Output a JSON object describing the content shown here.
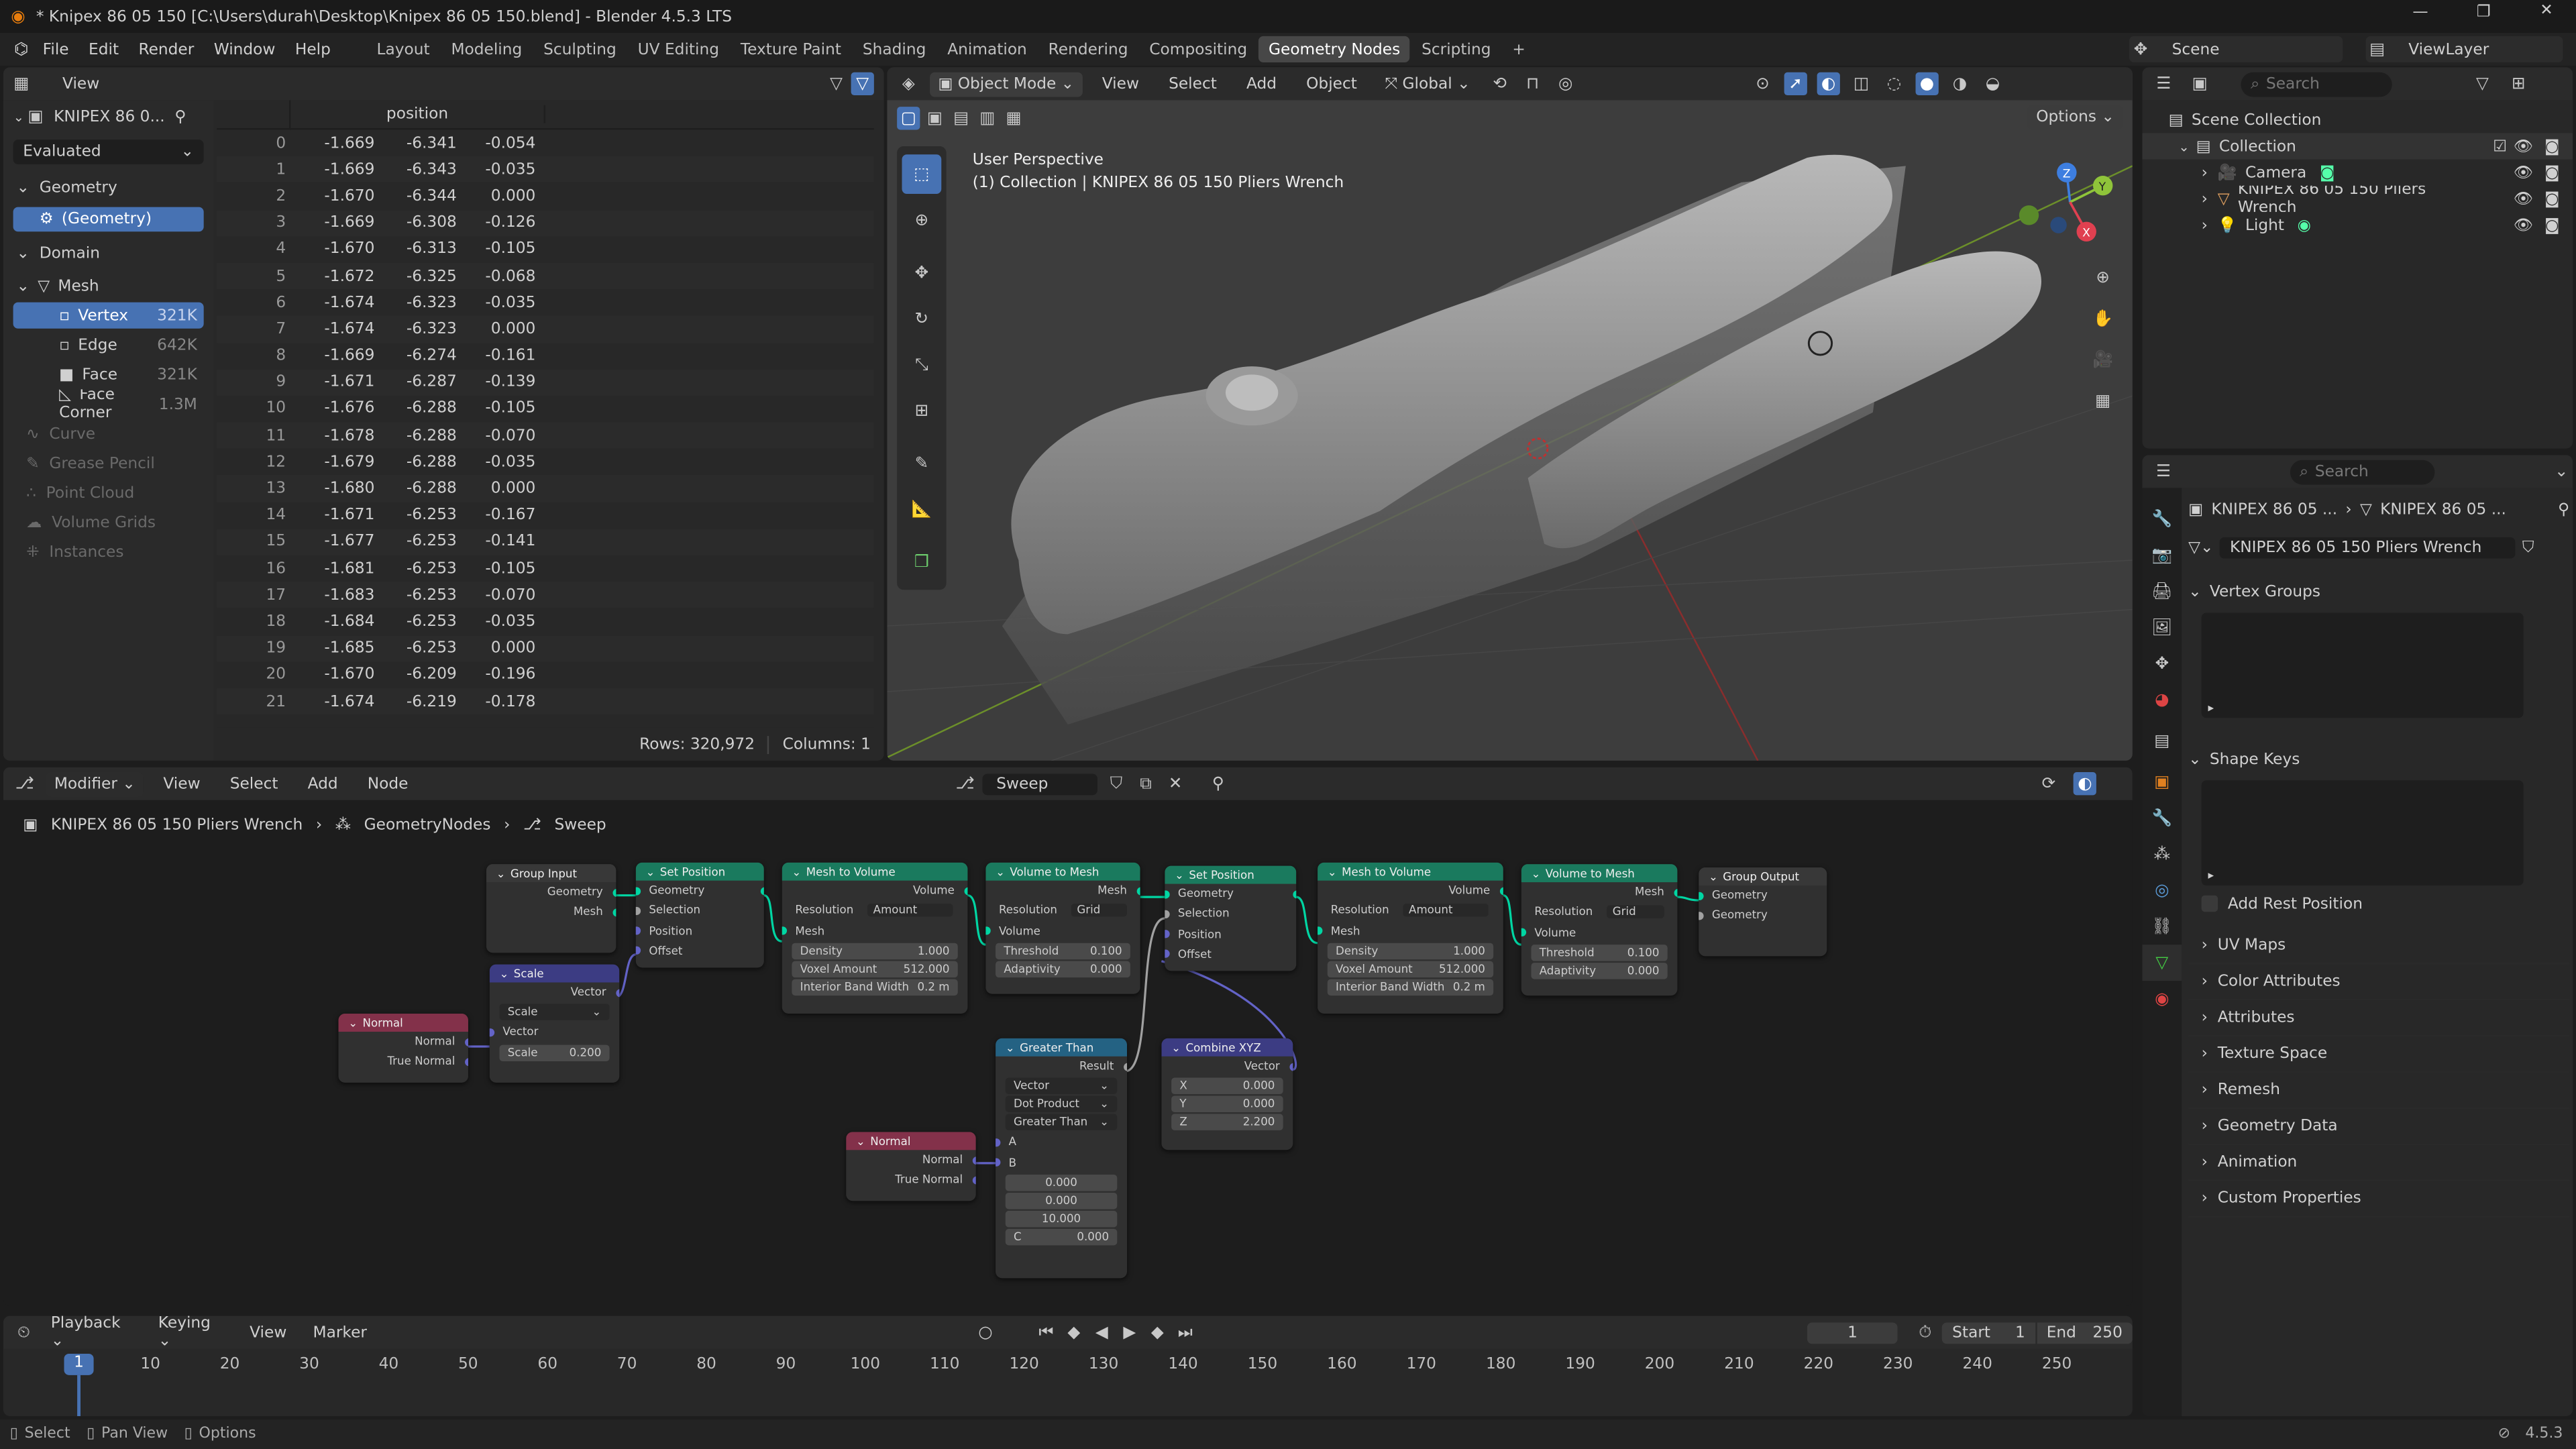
{
  "title": "* Knipex 86 05 150 [C:\\Users\\durah\\Desktop\\Knipex 86 05 150.blend] - Blender 4.5.3 LTS",
  "menu": [
    "File",
    "Edit",
    "Render",
    "Window",
    "Help"
  ],
  "workspaces": [
    "Layout",
    "Modeling",
    "Sculpting",
    "UV Editing",
    "Texture Paint",
    "Shading",
    "Animation",
    "Rendering",
    "Compositing",
    "Geometry Nodes",
    "Scripting"
  ],
  "active_workspace": "Geometry Nodes",
  "scene": "Scene",
  "view_layer": "ViewLayer",
  "spreadsheet": {
    "view_label": "View",
    "object": "KNIPEX 86 0...",
    "evaluated": "Evaluated",
    "geometry_label": "Geometry",
    "geometry_item": "(Geometry)",
    "domain_label": "Domain",
    "mesh": "Mesh",
    "domains": [
      {
        "n": "Vertex",
        "c": "321K"
      },
      {
        "n": "Edge",
        "c": "642K"
      },
      {
        "n": "Face",
        "c": "321K"
      },
      {
        "n": "Face Corner",
        "c": "1.3M"
      }
    ],
    "other": [
      "Curve",
      "Grease Pencil",
      "Point Cloud",
      "Volume Grids",
      "Instances"
    ],
    "column": "position",
    "rows": [
      [
        "0",
        "-1.669",
        "-6.341",
        "-0.054"
      ],
      [
        "1",
        "-1.669",
        "-6.343",
        "-0.035"
      ],
      [
        "2",
        "-1.670",
        "-6.344",
        "0.000"
      ],
      [
        "3",
        "-1.669",
        "-6.308",
        "-0.126"
      ],
      [
        "4",
        "-1.670",
        "-6.313",
        "-0.105"
      ],
      [
        "5",
        "-1.672",
        "-6.325",
        "-0.068"
      ],
      [
        "6",
        "-1.674",
        "-6.323",
        "-0.035"
      ],
      [
        "7",
        "-1.674",
        "-6.323",
        "0.000"
      ],
      [
        "8",
        "-1.669",
        "-6.274",
        "-0.161"
      ],
      [
        "9",
        "-1.671",
        "-6.287",
        "-0.139"
      ],
      [
        "10",
        "-1.676",
        "-6.288",
        "-0.105"
      ],
      [
        "11",
        "-1.678",
        "-6.288",
        "-0.070"
      ],
      [
        "12",
        "-1.679",
        "-6.288",
        "-0.035"
      ],
      [
        "13",
        "-1.680",
        "-6.288",
        "0.000"
      ],
      [
        "14",
        "-1.671",
        "-6.253",
        "-0.167"
      ],
      [
        "15",
        "-1.677",
        "-6.253",
        "-0.141"
      ],
      [
        "16",
        "-1.681",
        "-6.253",
        "-0.105"
      ],
      [
        "17",
        "-1.683",
        "-6.253",
        "-0.070"
      ],
      [
        "18",
        "-1.684",
        "-6.253",
        "-0.035"
      ],
      [
        "19",
        "-1.685",
        "-6.253",
        "0.000"
      ],
      [
        "20",
        "-1.670",
        "-6.209",
        "-0.196"
      ],
      [
        "21",
        "-1.674",
        "-6.219",
        "-0.178"
      ]
    ],
    "rows_label": "Rows: 320,972",
    "cols_label": "Columns: 1"
  },
  "viewport": {
    "mode": "Object Mode",
    "menus": [
      "View",
      "Select",
      "Add",
      "Object"
    ],
    "orientation": "Global",
    "options": "Options",
    "perspective": "User Perspective",
    "collection": "(1) Collection | KNIPEX 86 05 150 Pliers Wrench",
    "axes": {
      "x": "X",
      "y": "Y",
      "z": "Z"
    }
  },
  "outliner": {
    "search": "Search",
    "root": "Scene Collection",
    "collection": "Collection",
    "items": [
      "Camera",
      "KNIPEX 86 05 150 Pliers Wrench",
      "Light"
    ]
  },
  "properties": {
    "search": "Search",
    "crumb1": "KNIPEX 86 05 ...",
    "crumb2": "KNIPEX 86 05 ...",
    "mesh_name": "KNIPEX 86 05 150 Pliers Wrench",
    "vertex_groups": "Vertex Groups",
    "shape_keys": "Shape Keys",
    "add_rest": "Add Rest Position",
    "panels": [
      "UV Maps",
      "Color Attributes",
      "Attributes",
      "Texture Space",
      "Remesh",
      "Geometry Data",
      "Animation",
      "Custom Properties"
    ]
  },
  "node_editor": {
    "type": "Modifier",
    "menus": [
      "View",
      "Select",
      "Add",
      "Node"
    ],
    "tree": "Sweep",
    "crumbs": [
      "KNIPEX 86 05 150 Pliers Wrench",
      "GeometryNodes",
      "Sweep"
    ],
    "n": {
      "gi": {
        "t": "Group Input",
        "a": "Geometry",
        "b": "Mesh"
      },
      "sp1": {
        "t": "Set Position",
        "a": "Geometry",
        "b": "Selection",
        "c": "Position",
        "d": "Offset"
      },
      "mtv1": {
        "t": "Mesh to Volume",
        "a": "Volume",
        "b": "Resolution",
        "bv": "Amount",
        "c": "Mesh",
        "d": "Density",
        "dv": "1.000",
        "e": "Voxel Amount",
        "ev": "512.000",
        "f": "Interior Band Width",
        "fv": "0.2 m"
      },
      "vtm1": {
        "t": "Volume to Mesh",
        "a": "Mesh",
        "b": "Resolution",
        "bv": "Grid",
        "c": "Volume",
        "d": "Threshold",
        "dv": "0.100",
        "e": "Adaptivity",
        "ev": "0.000"
      },
      "sp2": {
        "t": "Set Position",
        "a": "Geometry",
        "b": "Selection",
        "c": "Position",
        "d": "Offset"
      },
      "mtv2": {
        "t": "Mesh to Volume",
        "a": "Volume",
        "b": "Resolution",
        "bv": "Amount",
        "c": "Mesh",
        "d": "Density",
        "dv": "1.000",
        "e": "Voxel Amount",
        "ev": "512.000",
        "f": "Interior Band Width",
        "fv": "0.2 m"
      },
      "vtm2": {
        "t": "Volume to Mesh",
        "a": "Mesh",
        "b": "Resolution",
        "bv": "Grid",
        "c": "Volume",
        "d": "Threshold",
        "dv": "0.100",
        "e": "Adaptivity",
        "ev": "0.000"
      },
      "go": {
        "t": "Group Output",
        "a": "Geometry",
        "b": "Geometry"
      },
      "scale": {
        "t": "Scale",
        "a": "Vector",
        "b": "Scale",
        "c": "Vector",
        "d": "Scale",
        "dv": "0.200"
      },
      "normal1": {
        "t": "Normal",
        "a": "Normal",
        "b": "True Normal"
      },
      "gt": {
        "t": "Greater Than",
        "a": "Result",
        "b": "Vector",
        "c": "Dot Product",
        "d": "Greater Than",
        "e": "A",
        "f": "B",
        "g": "0.000",
        "h": "0.000",
        "i": "10.000",
        "j": "C",
        "jv": "0.000"
      },
      "cxyz": {
        "t": "Combine XYZ",
        "a": "Vector",
        "x": "X",
        "xv": "0.000",
        "y": "Y",
        "yv": "0.000",
        "z": "Z",
        "zv": "2.200"
      },
      "normal2": {
        "t": "Normal",
        "a": "Normal",
        "b": "True Normal"
      }
    }
  },
  "timeline": {
    "menus": [
      "Playback",
      "Keying",
      "View",
      "Marker"
    ],
    "frame": "1",
    "start_label": "Start",
    "start": "1",
    "end_label": "End",
    "end": "250",
    "ticks": [
      "10",
      "20",
      "30",
      "40",
      "50",
      "60",
      "70",
      "80",
      "90",
      "100",
      "110",
      "120",
      "130",
      "140",
      "150",
      "160",
      "170",
      "180",
      "190",
      "200",
      "210",
      "220",
      "230",
      "240",
      "250"
    ],
    "current": "1"
  },
  "status": {
    "select": "Select",
    "pan": "Pan View",
    "options": "Options",
    "version": "4.5.3"
  },
  "colors": {
    "accent": "#4772b3",
    "geometry_header": "#1a7a5e",
    "vector_header": "#3c3c83",
    "input_header": "#83314a",
    "converter_header": "#246283"
  }
}
